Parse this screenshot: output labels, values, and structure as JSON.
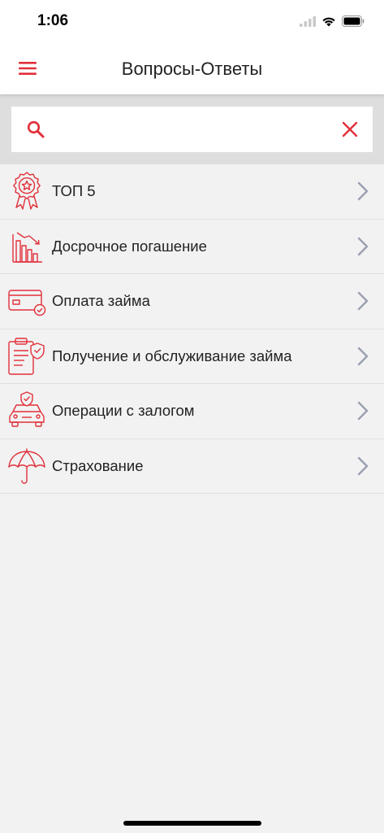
{
  "status_bar": {
    "time": "1:06"
  },
  "header": {
    "title": "Вопросы-Ответы",
    "menu_icon": "hamburger-icon"
  },
  "search": {
    "placeholder": "",
    "value": "",
    "search_icon": "search-icon",
    "clear_icon": "close-icon"
  },
  "items": [
    {
      "label": "ТОП 5",
      "icon": "award-badge-icon"
    },
    {
      "label": "Досрочное погашение",
      "icon": "declining-chart-icon"
    },
    {
      "label": "Оплата займа",
      "icon": "card-payment-icon"
    },
    {
      "label": "Получение и обслуживание займа",
      "icon": "document-check-icon"
    },
    {
      "label": "Операции с залогом",
      "icon": "car-shield-icon"
    },
    {
      "label": "Страхование",
      "icon": "umbrella-icon"
    }
  ],
  "colors": {
    "accent": "#e1303a",
    "chevron": "#9aa0b0",
    "background": "#f2f2f2"
  }
}
